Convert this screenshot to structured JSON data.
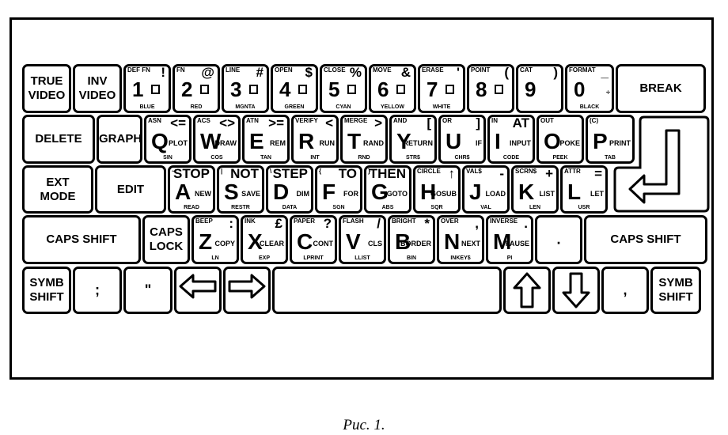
{
  "caption": "Рис. 1.",
  "rows": [
    {
      "keys": [
        {
          "label": [
            "TRUE",
            "VIDEO"
          ]
        },
        {
          "label": [
            "INV",
            "VIDEO"
          ]
        },
        {
          "main": "1",
          "top_left": "DEF FN",
          "top_right": "!",
          "bottom": "BLUE",
          "graphic": "block"
        },
        {
          "main": "2",
          "top_left": "FN",
          "top_right": "@",
          "bottom": "RED",
          "graphic": "block"
        },
        {
          "main": "3",
          "top_left": "LINE",
          "top_right": "#",
          "bottom": "MGNTA",
          "graphic": "block"
        },
        {
          "main": "4",
          "top_left": "OPEN",
          "top_right": "$",
          "bottom": "GREEN",
          "graphic": "block"
        },
        {
          "main": "5",
          "top_left": "CLOSE",
          "top_right": "%",
          "bottom": "CYAN",
          "graphic": "block"
        },
        {
          "main": "6",
          "top_left": "MOVE",
          "top_right": "&",
          "bottom": "YELLOW",
          "graphic": "block"
        },
        {
          "main": "7",
          "top_left": "ERASE",
          "top_right": "'",
          "bottom": "WHITE",
          "graphic": "block"
        },
        {
          "main": "8",
          "top_left": "POINT",
          "top_right": "(",
          "graphic": "block"
        },
        {
          "main": "9",
          "top_left": "CAT",
          "top_right": ")"
        },
        {
          "main": "0",
          "top_left": "FORMAT",
          "top_right": "_",
          "right": "÷",
          "bottom": "BLACK"
        },
        {
          "label": [
            "BREAK"
          ]
        }
      ]
    },
    {
      "keys": [
        {
          "label": [
            "DELETE"
          ]
        },
        {
          "label": [
            "GRAPH"
          ]
        },
        {
          "main": "Q",
          "top_left": "ASN",
          "top_right": "<=",
          "right": "PLOT",
          "bottom": "SIN"
        },
        {
          "main": "W",
          "top_left": "ACS",
          "top_right": "<>",
          "right": "DRAW",
          "bottom": "COS"
        },
        {
          "main": "E",
          "top_left": "ATN",
          "top_right": ">=",
          "right": "REM",
          "bottom": "TAN"
        },
        {
          "main": "R",
          "top_left": "VERIFY",
          "top_right": "<",
          "right": "RUN",
          "bottom": "INT"
        },
        {
          "main": "T",
          "top_left": "MERGE",
          "top_right": ">",
          "right": "RAND",
          "bottom": "RND"
        },
        {
          "main": "Y",
          "top_left": "AND",
          "top_right": "[",
          "right": "RETURN",
          "bottom": "STR$"
        },
        {
          "main": "U",
          "top_left": "OR",
          "top_right": "]",
          "right": "IF",
          "bottom": "CHR$"
        },
        {
          "main": "I",
          "top_left": "IN",
          "top_right": "AT",
          "right": "INPUT",
          "bottom": "CODE"
        },
        {
          "main": "O",
          "top_left": "OUT",
          "right": "POKE",
          "bottom": "PEEK"
        },
        {
          "main": "P",
          "top_left": "(C)",
          "right": "PRINT",
          "bottom": "TAB"
        }
      ]
    },
    {
      "keys": [
        {
          "label": [
            "EXT",
            "MODE"
          ]
        },
        {
          "label": [
            "EDIT"
          ]
        },
        {
          "main": "A",
          "top_left": "~",
          "top_right": "STOP",
          "right": "NEW",
          "bottom": "READ"
        },
        {
          "main": "S",
          "top_left": "|",
          "top_right": "NOT",
          "right": "SAVE",
          "bottom": "RESTR"
        },
        {
          "main": "D",
          "top_left": "\\",
          "top_right": "STEP",
          "right": "DIM",
          "bottom": "DATA"
        },
        {
          "main": "F",
          "top_left": "{",
          "top_right": "TO",
          "right": "FOR",
          "bottom": "SGN"
        },
        {
          "main": "G",
          "top_left": "}",
          "top_right": "THEN",
          "right": "GOTO",
          "bottom": "ABS"
        },
        {
          "main": "H",
          "top_left": "CIRCLE",
          "top_right": "↑",
          "right": "GOSUB",
          "bottom": "SQR"
        },
        {
          "main": "J",
          "top_left": "VAL$",
          "top_right": "-",
          "right": "LOAD",
          "bottom": "VAL"
        },
        {
          "main": "K",
          "top_left": "SCRN$",
          "top_right": "+",
          "right": "LIST",
          "bottom": "LEN"
        },
        {
          "main": "L",
          "top_left": "ATTR",
          "top_right": "=",
          "right": "LET",
          "bottom": "USR"
        }
      ]
    },
    {
      "keys": [
        {
          "label": [
            "CAPS SHIFT"
          ]
        },
        {
          "label": [
            "CAPS",
            "LOCK"
          ]
        },
        {
          "main": "Z",
          "top_left": "BEEP",
          "top_right": ":",
          "right": "COPY",
          "bottom": "LN"
        },
        {
          "main": "X",
          "top_left": "INK",
          "top_right": "£",
          "right": "CLEAR",
          "bottom": "EXP"
        },
        {
          "main": "C",
          "top_left": "PAPER",
          "top_right": "?",
          "right": "CONT",
          "bottom": "LPRINT"
        },
        {
          "main": "V",
          "top_left": "FLASH",
          "top_right": "/",
          "right": "CLS",
          "bottom": "LLIST"
        },
        {
          "main": "B",
          "top_left": "BRIGHT",
          "top_right": "*",
          "right": "BORDER",
          "bottom": "BIN"
        },
        {
          "main": "N",
          "top_left": "OVER",
          "top_right": ",",
          "right": "NEXT",
          "bottom": "INKEY$"
        },
        {
          "main": "M",
          "top_left": "INVERSE",
          "top_right": ".",
          "right": "PAUSE",
          "bottom": "PI"
        },
        {
          "symbol": "."
        },
        {
          "label": [
            "CAPS SHIFT"
          ]
        }
      ]
    },
    {
      "keys": [
        {
          "label": [
            "SYMB",
            "SHIFT"
          ]
        },
        {
          "symbol": ";"
        },
        {
          "symbol": "\""
        },
        {
          "icon": "arrow-left"
        },
        {
          "icon": "arrow-right"
        },
        {
          "icon": "space"
        },
        {
          "icon": "arrow-up"
        },
        {
          "icon": "arrow-down"
        },
        {
          "symbol": ","
        },
        {
          "label": [
            "SYMB",
            "SHIFT"
          ]
        }
      ]
    }
  ],
  "enter_key": {
    "icon": "enter-arrow"
  }
}
